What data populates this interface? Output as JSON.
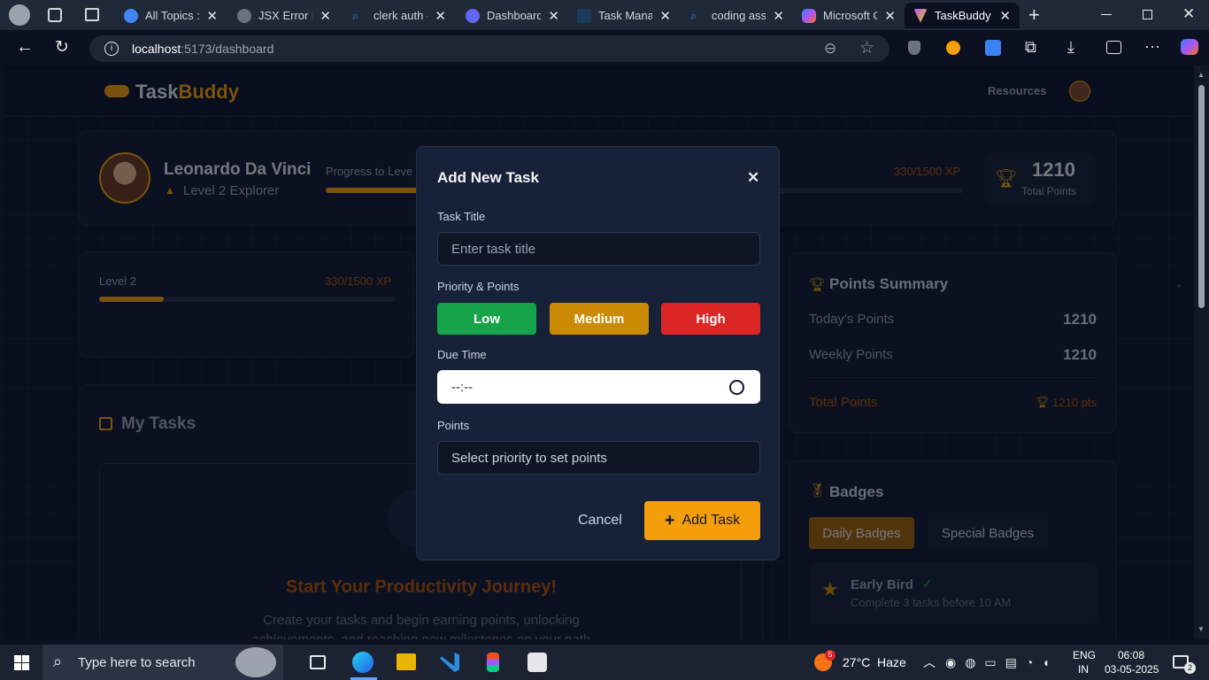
{
  "browser": {
    "tabs": [
      {
        "title": "All Topics : G",
        "color": "#4285f4",
        "active": false
      },
      {
        "title": "JSX Error in C",
        "color": "#9ca3af",
        "active": false
      },
      {
        "title": "clerk auth - S",
        "color": "#3b82f6",
        "active": false
      },
      {
        "title": "Dashboard |",
        "color": "#6366f1",
        "active": false
      },
      {
        "title": "Task Manage",
        "color": "#1e3a5f",
        "active": false
      },
      {
        "title": "coding assis",
        "color": "#3b82f6",
        "active": false
      },
      {
        "title": "Microsoft Co",
        "color": "#8b5cf6",
        "active": false
      },
      {
        "title": "TaskBuddy -",
        "color": "#a855f7",
        "active": true
      }
    ],
    "url_host": "localhost",
    "url_path": ":5173/dashboard"
  },
  "app": {
    "logo_task": "Task",
    "logo_buddy": "Buddy",
    "nav_resources": "Resources"
  },
  "profile": {
    "name": "Leonardo Da Vinci",
    "level_title": "Level 2 Explorer",
    "progress_label": "Progress to Leve",
    "xp": "330/1500 XP",
    "total_points_value": "1210",
    "total_points_label": "Total Points",
    "progress_fraction": 0.22
  },
  "level_card": {
    "level": "Level 2",
    "xp": "330/1500 XP",
    "progress_fraction": 0.22
  },
  "tasks": {
    "title": "My Tasks",
    "empty_title": "Start Your Productivity Journey!",
    "empty_line1": "Create your tasks and begin earning points, unlocking",
    "empty_line2": "achievements, and reaching new milestones on your path"
  },
  "points_summary": {
    "title": "Points Summary",
    "today_label": "Today's Points",
    "today_value": "1210",
    "weekly_label": "Weekly Points",
    "weekly_value": "1210",
    "total_label": "Total Points",
    "total_value": "1210 pts"
  },
  "badges": {
    "title": "Badges",
    "tab_daily": "Daily Badges",
    "tab_special": "Special Badges",
    "item_name": "Early Bird",
    "item_desc": "Complete 3 tasks before 10 AM"
  },
  "modal": {
    "title": "Add New Task",
    "task_title_label": "Task Title",
    "task_title_placeholder": "Enter task title",
    "priority_label": "Priority & Points",
    "low": "Low",
    "medium": "Medium",
    "high": "High",
    "due_label": "Due Time",
    "due_value": "--:--",
    "points_label": "Points",
    "points_placeholder": "Select priority to set points",
    "cancel": "Cancel",
    "add": "Add Task",
    "colors": {
      "low": "#16a34a",
      "medium": "#ca8a04",
      "high": "#dc2626",
      "add": "#f59e0b"
    }
  },
  "taskbar": {
    "search_placeholder": "Type here to search",
    "weather": "27°C  Haze",
    "weather_badge": "5",
    "lang1": "ENG",
    "lang2": "IN",
    "time": "06:08",
    "date": "03-05-2025",
    "notif": "2"
  }
}
